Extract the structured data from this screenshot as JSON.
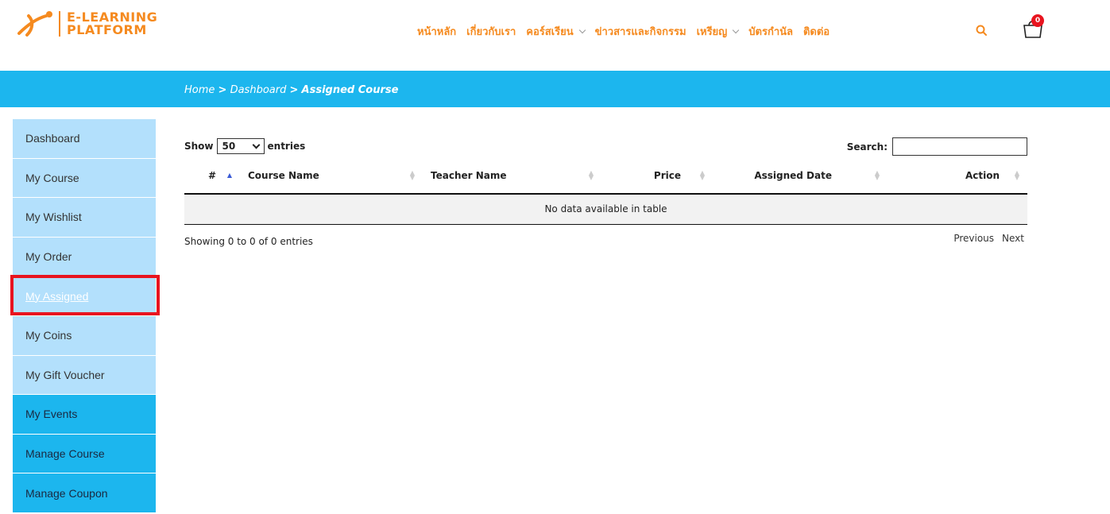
{
  "brand": {
    "line1": "E-LEARNING",
    "line2": "PLATFORM"
  },
  "nav": {
    "items": [
      {
        "label": "หน้าหลัก",
        "dropdown": false
      },
      {
        "label": "เกี่ยวกับเรา",
        "dropdown": false
      },
      {
        "label": "คอร์สเรียน",
        "dropdown": true
      },
      {
        "label": "ข่าวสารและกิจกรรม",
        "dropdown": false
      },
      {
        "label": "เหรียญ",
        "dropdown": true
      },
      {
        "label": "บัตรกำนัล",
        "dropdown": false
      },
      {
        "label": "ติดต่อ",
        "dropdown": false
      }
    ],
    "cart_count": "0"
  },
  "breadcrumb": {
    "home": "Home",
    "sep": ">",
    "dashboard": "Dashboard",
    "current": "Assigned Course"
  },
  "sidebar": {
    "items": [
      {
        "label": "Dashboard"
      },
      {
        "label": "My Course"
      },
      {
        "label": "My Wishlist"
      },
      {
        "label": "My Order"
      },
      {
        "label": "My Assigned"
      },
      {
        "label": "My Coins"
      },
      {
        "label": "My Gift Voucher"
      },
      {
        "label": "My Events"
      },
      {
        "label": "Manage Course"
      },
      {
        "label": "Manage Coupon"
      }
    ]
  },
  "table": {
    "show_label": "Show",
    "entries_value": "50",
    "entries_label": "entries",
    "search_label": "Search:",
    "columns": [
      "#",
      "Course Name",
      "Teacher Name",
      "Price",
      "Assigned Date",
      "Action"
    ],
    "empty_message": "No data available in table",
    "info": "Showing 0 to 0 of 0 entries",
    "prev": "Previous",
    "next": "Next"
  },
  "colors": {
    "brand_orange": "#f58a1f",
    "banner_blue": "#1cb6ee",
    "sidebar_light": "#b3e0fc",
    "highlight_red": "#e8141f"
  }
}
